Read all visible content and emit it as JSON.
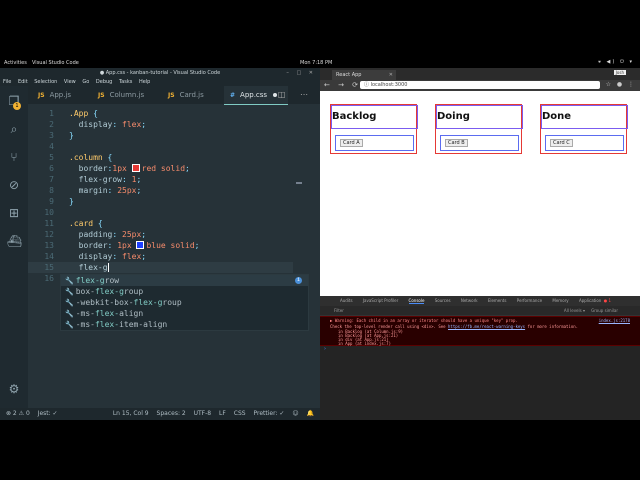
{
  "topbar": {
    "activities": "Activities",
    "app_name": "Visual Studio Code",
    "clock": "Mon 7:18 PM"
  },
  "vscode": {
    "window_title": "● App.css - kanban-tutorial - Visual Studio Code",
    "menu": [
      "File",
      "Edit",
      "Selection",
      "View",
      "Go",
      "Debug",
      "Tasks",
      "Help"
    ],
    "badge_count": "1",
    "tabs": [
      {
        "lang": "JS",
        "label": "App.js"
      },
      {
        "lang": "JS",
        "label": "Column.js"
      },
      {
        "lang": "JS",
        "label": "Card.js"
      },
      {
        "lang": "#",
        "label": "App.css"
      }
    ],
    "line_numbers": [
      "1",
      "2",
      "3",
      "4",
      "5",
      "6",
      "7",
      "8",
      "9",
      "10",
      "11",
      "12",
      "13",
      "14",
      "15",
      "16"
    ],
    "code": {
      "l1_sel": ".App",
      "l1_brace": " {",
      "l2_prop": "display",
      "l2_val": "flex",
      "l3": "}",
      "l5_sel": ".column",
      "l5_brace": " {",
      "l6_prop": "border",
      "l6_val1": "1px",
      "l6_val2": "red solid",
      "l7_prop": "flex-grow",
      "l7_val": "1",
      "l8_prop": "margin",
      "l8_val": "25px",
      "l9": "}",
      "l11_sel": ".card",
      "l11_brace": " {",
      "l12_prop": "padding",
      "l12_val": "25px",
      "l13_prop": "border",
      "l13_val1": "1px",
      "l13_val2": "blue solid",
      "l14_prop": "display",
      "l14_val": "flex",
      "l15_text": "flex-g"
    },
    "suggestions": [
      {
        "pre": "",
        "match": "flex-g",
        "post": "row"
      },
      {
        "pre": "box-",
        "match": "flex-g",
        "post": "roup"
      },
      {
        "pre": "-webkit-box-",
        "match": "flex-g",
        "post": "roup"
      },
      {
        "pre": "-ms-",
        "match": "flex-",
        "post": "align"
      },
      {
        "pre": "-ms-",
        "match": "flex-",
        "post": "item-align"
      }
    ],
    "status": {
      "errors": "⊗ 2  ⚠ 0",
      "jest": "Jest: ✓",
      "position": "Ln 15, Col 9",
      "spaces": "Spaces: 2",
      "encoding": "UTF-8",
      "eol": "LF",
      "lang": "CSS",
      "prettier": "Prettier: ✓"
    },
    "colors": {
      "swatch_red": "#e53935",
      "swatch_blue": "#1e40ff"
    }
  },
  "browser": {
    "tab_title": "React App",
    "user": "Josh",
    "url": "localhost:3000",
    "columns": [
      {
        "title": "Backlog",
        "card": "Card A"
      },
      {
        "title": "Doing",
        "card": "Card B"
      },
      {
        "title": "Done",
        "card": "Card C"
      }
    ],
    "devtools": {
      "tabs": [
        "Audits",
        "JavaScript Profiler",
        "Console",
        "Sources",
        "Network",
        "Elements",
        "Performance",
        "Memory",
        "Application"
      ],
      "filter": "Filter",
      "levels": "All levels ▾",
      "group": "Group similar",
      "error_line1": "▶ Warning: Each child in an array or iterator should have a unique \"key\" prop.",
      "error_line2": "Check the top-level render call using <div>. See",
      "error_link": "https://fb.me/react-warning-keys",
      "error_line2_end": "for more information.",
      "error_source": "index.js:2178",
      "trace": [
        "in Backlog (at Column.js:9)",
        "in Backlog (at App.js:21)",
        "in div (at App.js:21)",
        "in App (at index.js:7)"
      ],
      "error_count": "● 1"
    }
  }
}
